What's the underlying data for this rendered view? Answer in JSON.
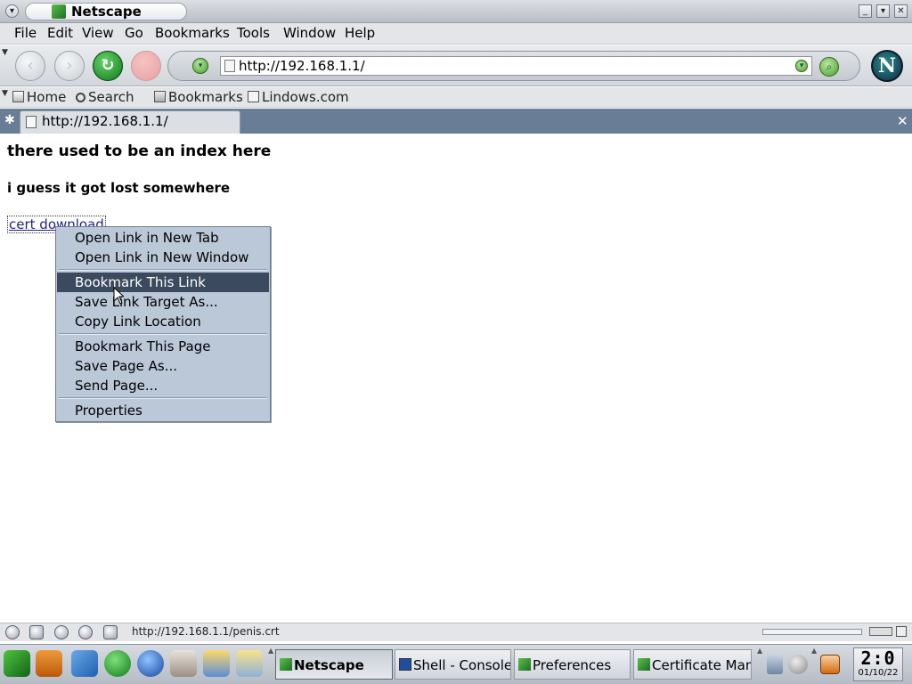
{
  "window": {
    "title": "Netscape",
    "icons": {
      "menu": "chevron-down-icon",
      "minimize": "minimize-icon",
      "maximize": "maximize-icon",
      "close": "close-icon"
    }
  },
  "menubar": {
    "items": [
      "File",
      "Edit",
      "View",
      "Go",
      "Bookmarks",
      "Tools",
      "Window",
      "Help"
    ]
  },
  "navbar": {
    "url": "http://192.168.1.1/"
  },
  "personal_toolbar": {
    "items": [
      "Home",
      "Search",
      "Bookmarks",
      "Lindows.com"
    ]
  },
  "tabs": [
    {
      "label": "http://192.168.1.1/",
      "active": true
    }
  ],
  "page": {
    "heading": "there used to be an index here",
    "subheading": "i guess it got lost somewhere",
    "link_text": "cert download"
  },
  "context_menu": {
    "items": [
      "Open Link in New Tab",
      "Open Link in New Window",
      "Bookmark This Link",
      "Save Link Target As...",
      "Copy Link Location",
      "Bookmark This Page",
      "Save Page As...",
      "Send Page...",
      "Properties"
    ],
    "selected": "Bookmark This Link"
  },
  "statusbar": {
    "text": "http://192.168.1.1/penis.crt"
  },
  "taskbar": {
    "tasks": [
      "Netscape",
      "Shell - Console",
      "Preferences",
      "Certificate Mana"
    ],
    "active_task": "Netscape",
    "clock_time": "2:0",
    "clock_date": "01/10/22"
  },
  "colors": {
    "tab_bar": "#697e96",
    "menu_bg": "#bac8d8",
    "menu_selected": "#3b4a5e",
    "link": "#22228c"
  }
}
